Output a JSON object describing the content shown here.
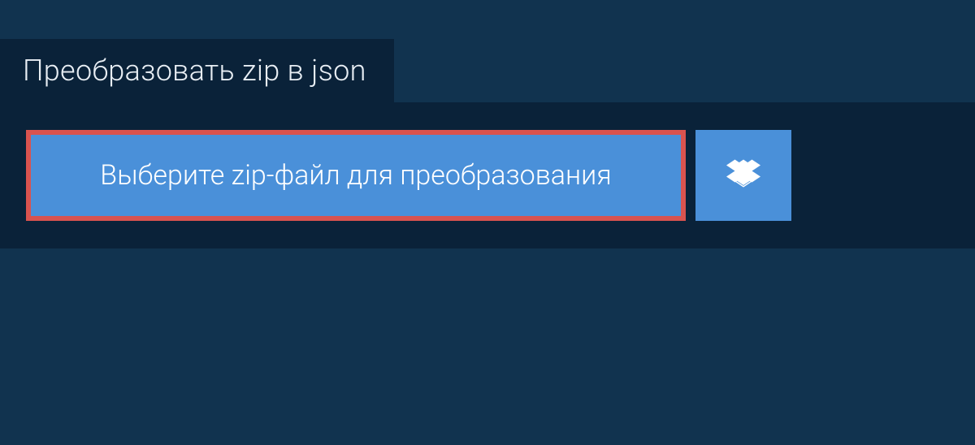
{
  "tab": {
    "title": "Преобразовать zip в json"
  },
  "upload": {
    "choose_file_label": "Выберите zip-файл для преобразования",
    "dropbox_icon": "dropbox-icon"
  },
  "colors": {
    "page_bg": "#11334f",
    "panel_bg": "#0a2239",
    "button_bg": "#4a90d9",
    "highlight_border": "#d9534f",
    "text": "#ffffff"
  }
}
